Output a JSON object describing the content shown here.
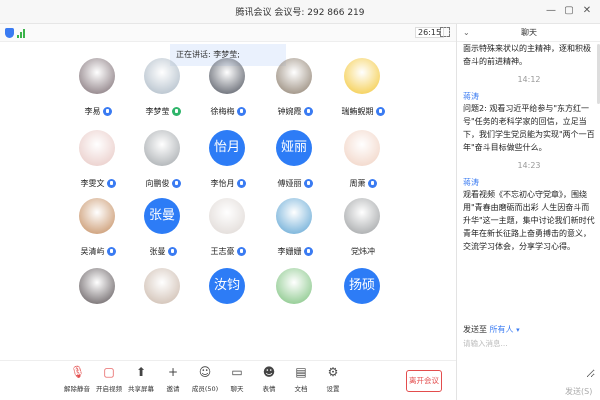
{
  "window": {
    "title": "腾讯会议 会议号: 292 866 219"
  },
  "status": {
    "timer": "26:15"
  },
  "speaking": {
    "text": "正在讲话: 李梦莹;"
  },
  "participants": [
    {
      "name": "李易",
      "avatar_text": "",
      "color": "#7a6a70",
      "mic": "blue"
    },
    {
      "name": "李梦莹",
      "avatar_text": "",
      "color": "#a9b7c4",
      "mic": "green"
    },
    {
      "name": "徐梅梅",
      "avatar_text": "",
      "color": "#4a4f5a",
      "mic": "blue"
    },
    {
      "name": "钟婉霞",
      "avatar_text": "",
      "color": "#8a7b6a",
      "mic": "blue"
    },
    {
      "name": "瑞鲔鲵期",
      "avatar_text": "",
      "color": "#f3c634",
      "mic": "blue"
    },
    {
      "name": "李雯文",
      "avatar_text": "",
      "color": "#e7c6c2",
      "mic": "blue"
    },
    {
      "name": "向鹏俊",
      "avatar_text": "",
      "color": "#9fa4a8",
      "mic": "blue"
    },
    {
      "name": "李怡月",
      "avatar_text": "怡月",
      "color": "#2d7cf6",
      "mic": "blue"
    },
    {
      "name": "傅娅丽",
      "avatar_text": "娅丽",
      "color": "#2d7cf6",
      "mic": "blue"
    },
    {
      "name": "周萧",
      "avatar_text": "",
      "color": "#f0d0c0",
      "mic": "blue"
    },
    {
      "name": "吴清屿",
      "avatar_text": "",
      "color": "#c38a5b",
      "mic": "blue"
    },
    {
      "name": "张曼",
      "avatar_text": "张曼",
      "color": "#2d7cf6",
      "mic": "blue"
    },
    {
      "name": "王志豪",
      "avatar_text": "",
      "color": "#ddd6d2",
      "mic": "blue"
    },
    {
      "name": "李姗姗",
      "avatar_text": "",
      "color": "#5aa2d2",
      "mic": "blue"
    },
    {
      "name": "党炜冲",
      "avatar_text": "",
      "color": "#999c9e",
      "mic": "none"
    },
    {
      "name": "",
      "avatar_text": "",
      "color": "#5a5255",
      "mic": "none"
    },
    {
      "name": "",
      "avatar_text": "",
      "color": "#c9b6a8",
      "mic": "none"
    },
    {
      "name": "",
      "avatar_text": "汝钧",
      "color": "#2d7cf6",
      "mic": "none"
    },
    {
      "name": "",
      "avatar_text": "",
      "color": "#79c07a",
      "mic": "none"
    },
    {
      "name": "",
      "avatar_text": "扬硕",
      "color": "#2d7cf6",
      "mic": "none"
    }
  ],
  "toolbar": {
    "items": [
      {
        "label": "解除静音",
        "icon": "mic-off-icon",
        "glyph": "🎙"
      },
      {
        "label": "开启视频",
        "icon": "camera-off-icon",
        "glyph": "▢"
      },
      {
        "label": "共享屏幕",
        "icon": "share-screen-icon",
        "glyph": "⬆"
      },
      {
        "label": "邀请",
        "icon": "invite-icon",
        "glyph": "+"
      },
      {
        "label": "成员(50)",
        "icon": "members-icon",
        "glyph": "☺"
      },
      {
        "label": "聊天",
        "icon": "chat-icon",
        "glyph": "▭"
      },
      {
        "label": "表情",
        "icon": "emoji-icon",
        "glyph": "☻"
      },
      {
        "label": "文档",
        "icon": "document-icon",
        "glyph": "▤"
      },
      {
        "label": "设置",
        "icon": "settings-icon",
        "glyph": "⚙"
      }
    ],
    "leave_label": "离开会议"
  },
  "chat": {
    "title": "聊天",
    "messages_top": "面示特殊来状以的主精神，逐和积极奋斗的前进精神。",
    "ts1": "14:12",
    "sender1": "蒋涛",
    "msg1": "问题2: 观看习近平给参与\"东方红一号\"任务的老科学家的回信，立足当下，我们学生党员能为实现\"两个一百年\"奋斗目标做些什么。",
    "ts2": "14:23",
    "sender2": "蒋涛",
    "msg2": "观看视频《不忘初心守党章》，围绕用\"青春由磨砺而出彩 人生因奋斗而升华\"这一主题，集中讨论我们新时代青年在新长征路上奋勇搏击的意义，交流学习体会，分享学习心得。",
    "send_to_label": "发送至",
    "send_to_target": "所有人",
    "input_placeholder": "请输入消息...",
    "send_label": "发送(S)"
  },
  "colors": {
    "accent": "#2d7cf6",
    "danger": "#e34d4d",
    "speaking_bg": "#eaf1fd"
  }
}
